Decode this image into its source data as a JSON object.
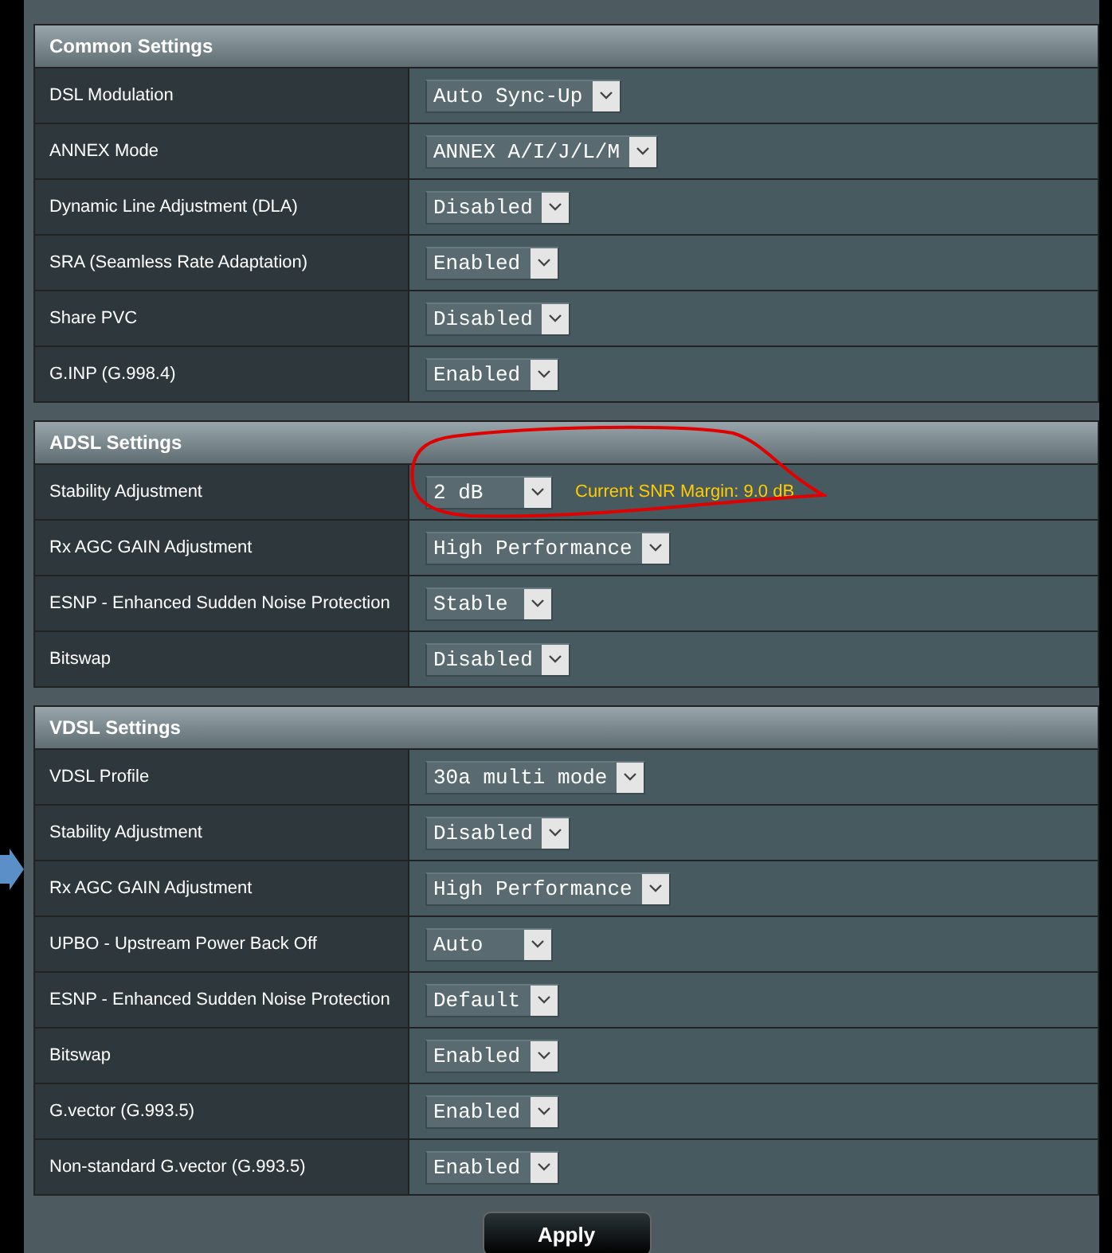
{
  "sections": [
    {
      "title": "Common Settings",
      "rows": [
        {
          "label": "DSL Modulation",
          "value": "Auto Sync-Up"
        },
        {
          "label": "ANNEX Mode",
          "value": "ANNEX A/I/J/L/M"
        },
        {
          "label": "Dynamic Line Adjustment (DLA)",
          "value": "Disabled"
        },
        {
          "label": "SRA (Seamless Rate Adaptation)",
          "value": "Enabled"
        },
        {
          "label": "Share PVC",
          "value": "Disabled"
        },
        {
          "label": "G.INP (G.998.4)",
          "value": "Enabled"
        }
      ]
    },
    {
      "title": "ADSL Settings",
      "rows": [
        {
          "label": "Stability Adjustment",
          "value": "2 dB",
          "note": "Current SNR Margin: 9.0 dB"
        },
        {
          "label": "Rx AGC GAIN Adjustment",
          "value": "High Performance"
        },
        {
          "label": "ESNP - Enhanced Sudden Noise Protection",
          "value": "Stable"
        },
        {
          "label": "Bitswap",
          "value": "Disabled"
        }
      ]
    },
    {
      "title": "VDSL Settings",
      "rows": [
        {
          "label": "VDSL Profile",
          "value": "30a multi mode"
        },
        {
          "label": "Stability Adjustment",
          "value": "Disabled"
        },
        {
          "label": "Rx AGC GAIN Adjustment",
          "value": "High Performance"
        },
        {
          "label": "UPBO - Upstream Power Back Off",
          "value": "Auto"
        },
        {
          "label": "ESNP - Enhanced Sudden Noise Protection",
          "value": "Default"
        },
        {
          "label": "Bitswap",
          "value": "Enabled"
        },
        {
          "label": "G.vector (G.993.5)",
          "value": "Enabled"
        },
        {
          "label": "Non-standard G.vector (G.993.5)",
          "value": "Enabled"
        }
      ]
    }
  ],
  "apply_button": "Apply"
}
